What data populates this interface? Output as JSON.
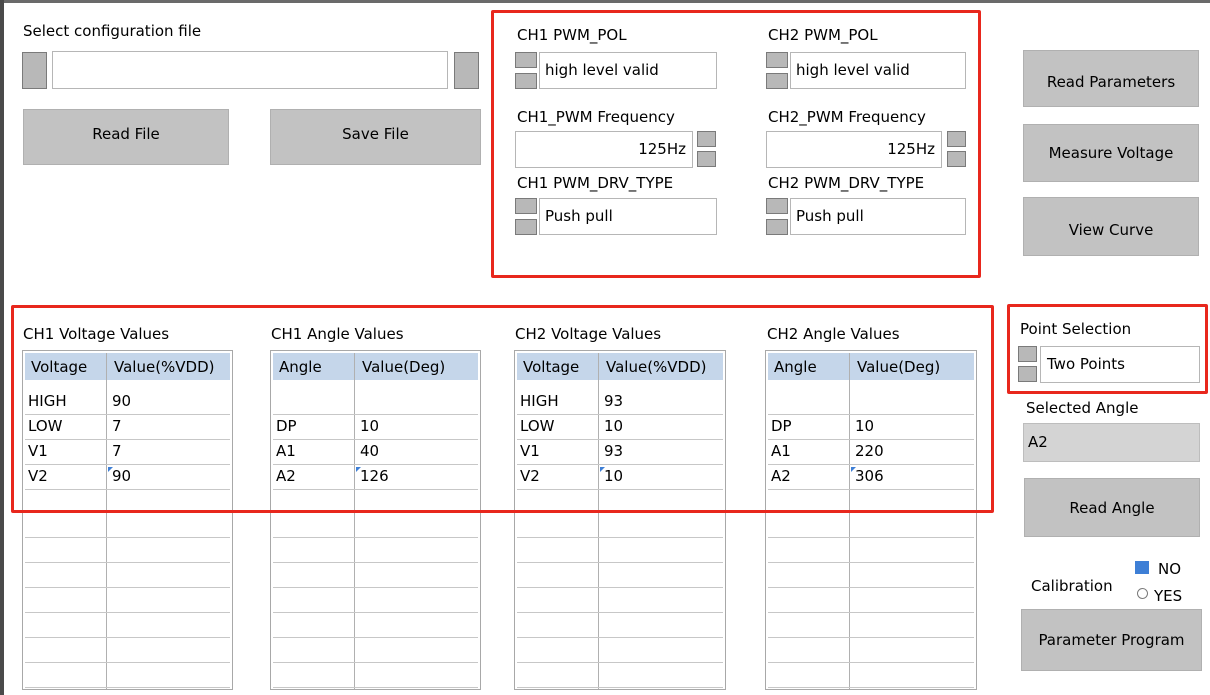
{
  "config": {
    "select_label": "Select configuration file",
    "path_value": "",
    "read_file": "Read File",
    "save_file": "Save File"
  },
  "pwm": {
    "ch1_pol_label": "CH1 PWM_POL",
    "ch1_pol_value": "high level valid",
    "ch2_pol_label": "CH2 PWM_POL",
    "ch2_pol_value": "high level valid",
    "ch1_freq_label": "CH1_PWM Frequency",
    "ch1_freq_value": "125Hz",
    "ch2_freq_label": "CH2_PWM Frequency",
    "ch2_freq_value": "125Hz",
    "ch1_drv_label": "CH1 PWM_DRV_TYPE",
    "ch1_drv_value": "Push pull",
    "ch2_drv_label": "CH2 PWM_DRV_TYPE",
    "ch2_drv_value": "Push pull"
  },
  "actions": {
    "read_parameters": "Read Parameters",
    "measure_voltage": "Measure  Voltage",
    "view_curve": "View Curve",
    "read_angle": "Read  Angle",
    "parameter_program": "Parameter Program"
  },
  "tables": [
    {
      "title": "CH1 Voltage Values",
      "headers": [
        "Voltage",
        "Value(%VDD)"
      ],
      "rows": [
        [
          "HIGH",
          "90"
        ],
        [
          "LOW",
          "7"
        ],
        [
          "V1",
          "7"
        ],
        [
          "V2",
          "90"
        ]
      ]
    },
    {
      "title": "CH1 Angle Values",
      "headers": [
        "Angle",
        "Value(Deg)"
      ],
      "rows": [
        [
          "",
          ""
        ],
        [
          "DP",
          "10"
        ],
        [
          "A1",
          "40"
        ],
        [
          "A2",
          "126"
        ]
      ]
    },
    {
      "title": "CH2 Voltage Values",
      "headers": [
        "Voltage",
        "Value(%VDD)"
      ],
      "rows": [
        [
          "HIGH",
          "93"
        ],
        [
          "LOW",
          "10"
        ],
        [
          "V1",
          "93"
        ],
        [
          "V2",
          "10"
        ]
      ]
    },
    {
      "title": "CH2 Angle Values",
      "headers": [
        "Angle",
        "Value(Deg)"
      ],
      "rows": [
        [
          "",
          ""
        ],
        [
          "DP",
          "10"
        ],
        [
          "A1",
          "220"
        ],
        [
          "A2",
          "306"
        ]
      ]
    }
  ],
  "point": {
    "label": "Point Selection",
    "value": "Two Points",
    "selected_angle_label": "Selected Angle",
    "selected_angle_value": "A2"
  },
  "calibration": {
    "label": "Calibration",
    "no": "NO",
    "yes": "YES",
    "selected": "NO"
  },
  "colors": {
    "highlight_red": "#e8271d",
    "button_gray": "#c2c2c2",
    "table_header": "#c5d6ea",
    "check_blue": "#3e7fd6"
  }
}
